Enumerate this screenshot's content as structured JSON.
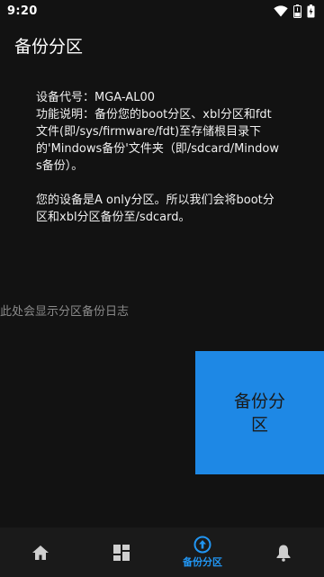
{
  "status_bar": {
    "time": "9:20"
  },
  "app_bar": {
    "title": "备份分区"
  },
  "info_text": "设备代号：MGA-AL00\n功能说明：备份您的boot分区、xbl分区和fdt文件(即/sys/firmware/fdt)至存储根目录下的'Mindows备份'文件夹（即/sdcard/Mindows备份）。\n\n您的设备是A only分区。所以我们会将boot分区和xbl分区备份至/sdcard。",
  "log_placeholder": "此处会显示分区备份日志",
  "backup_button": {
    "label": "备份分区"
  },
  "bottom_nav": {
    "items": [
      {
        "icon": "home-icon",
        "label": ""
      },
      {
        "icon": "dashboard-icon",
        "label": ""
      },
      {
        "icon": "upload-circle-icon",
        "label": "备份分区"
      },
      {
        "icon": "bell-icon",
        "label": ""
      }
    ],
    "active_index": 2
  },
  "colors": {
    "accent": "#2196f3",
    "button": "#1e88e5",
    "background": "#121212",
    "nav_background": "#1a1a1a"
  }
}
